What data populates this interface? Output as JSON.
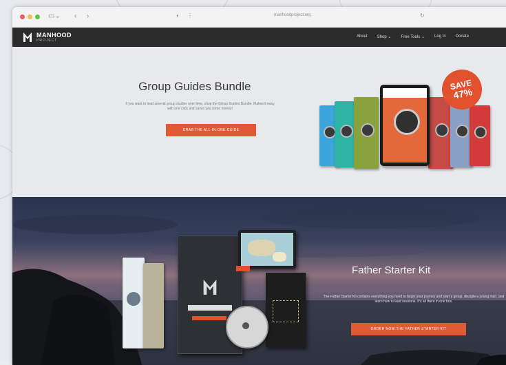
{
  "browser": {
    "address": "manhoodproject.org",
    "traffic_lights": [
      "close",
      "minimize",
      "zoom"
    ],
    "toolbar_icons": [
      "sidebar-icon",
      "back-icon",
      "forward-icon",
      "shield-icon",
      "reload-icon"
    ]
  },
  "site": {
    "logo_text": "MANHOOD",
    "logo_sub": "PROJECT",
    "nav": [
      "About",
      "Shop",
      "Free Tools",
      "Log In",
      "Donate"
    ],
    "nav_dropdown": [
      false,
      true,
      true,
      false,
      false
    ]
  },
  "hero1": {
    "title": "Group Guides Bundle",
    "description": "If you want to lead several group studies over time, shop the Group Guides Bundle. Makes it easy with one click and saves you some money!",
    "button": "Grab the all-in-one guide",
    "badge_line1": "SAVE",
    "badge_line2": "47%",
    "book_colors": [
      "#3aa6dc",
      "#2fb3a5",
      "#8aa23c",
      "#e3693a",
      "#c64a45",
      "#8aa0c4",
      "#d33a3a"
    ]
  },
  "hero2": {
    "title": "Father Starter Kit",
    "description": "The Father Starter Kit contains everything you need to begin your journey and start a group, disciple a young man, and learn how to lead sessions. It's all there in one box.",
    "button": "Order now the Father Starter Kit"
  },
  "colors": {
    "accent": "#e05a36",
    "nav_bg": "#2b2b2b",
    "hero1_bg": "#e8e9ec"
  }
}
